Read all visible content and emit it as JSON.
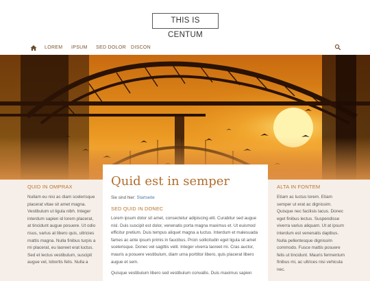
{
  "header": {
    "logo_text": "THIS IS CENTUM"
  },
  "nav": {
    "home_icon": "home-icon",
    "items": [
      "LOREM",
      "IPSUM",
      "SED DOLOR",
      "DISCON"
    ],
    "search_icon": "search-icon"
  },
  "hero": {
    "image": "sunset-bridge-with-birds"
  },
  "left": {
    "heading": "QUID IN OMPRAX",
    "text": "Nullam eu nisi ac diam scelerisque placerat vitae sit amet magna. Vestibulum ut ligula nibh. Integer interdum sapien id lorem placerat, at tincidunt augue posuere. Ut odio risus, varius at libero quis, ultricies mattis magna. Nulla finibus turpis a mi placerat, eu laoreet erat luctus. Sed et lectus vestibulum, suscipit augue vel, lobortis felis. Nulla a"
  },
  "main": {
    "title": "Quid est in semper",
    "breadcrumb_prefix": "Sie sind hier:",
    "breadcrumb_link": "Startseite",
    "subheading": "SED QUID IN DONEC",
    "paragraph1": "Lorem ipsum dolor sit amet, consectetur adipiscing elit. Curabitur sed augue nisl. Duis suscipit est dolor, venenatis porta magna maximus et. Ut euismod efficitur pretium. Duis tempus aliquet magna a luctus. Interdum et malesuada fames ac ante ipsum primis in faucibus. Proin sollicitudin eget ligula sit amet scelerisque. Donec vel sagittis velit. Integer viverra laoreet mi. Cras auctor, mauris a posuere vestibulum, diam urna porttitor libero, quis placerat libero augue et sem.",
    "paragraph2": "Quisque vestibulum libero sed vestibulum convallis. Duis maximus sapien"
  },
  "right": {
    "heading": "ALTA IN FONTEM",
    "text": "Etiam ac luctus lorem. Etiam semper ut erat ac dignissim. Quisque nec facilisis lacus. Donec eget finibus lectus. Suspendisse viverra varius aliquam. Ut at ipsum interdum est venenatis dapibus. Nulla pellentesque dignissim commodo. Fusce mattis posuere felis ut tincidunt. Mauris fermentum finibus mi, ac ultrices nisi vehicula nec."
  },
  "colors": {
    "accent": "#b8732a",
    "link": "#4b78a8",
    "page_bg": "#f6efe9"
  }
}
